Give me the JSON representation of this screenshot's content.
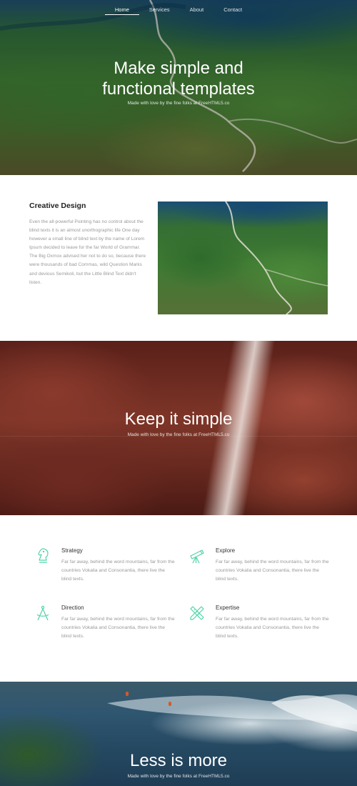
{
  "nav": {
    "items": [
      "Home",
      "Services",
      "About",
      "Contact"
    ],
    "active": "Home"
  },
  "hero": {
    "title_line1": "Make simple and",
    "title_line2": "functional templates",
    "subtitle": "Made with love by the fine folks at FreeHTML5.co"
  },
  "about": {
    "title": "Creative Design",
    "text": "Even the all-powerful Pointing has no control about the blind texts it is an almost unorthographic life One day however a small line of blind text by the name of Lorem Ipsum decided to leave for the far World of Grammar. The Big Oxmox advised her not to do so, because there were thousands of bad Commas, wild Question Marks and devious Semikoli, but the Little Blind Text didn't listen."
  },
  "banner2": {
    "title": "Keep it simple",
    "subtitle": "Made with love by the fine folks at FreeHTML5.co"
  },
  "services": {
    "accent_color": "#52d3aa",
    "items": [
      {
        "title": "Strategy",
        "icon": "chess-knight-icon",
        "text": "Far far away, behind the word mountains, far from the countries Vokalia and Consonantia, there live the blind texts."
      },
      {
        "title": "Explore",
        "icon": "telescope-icon",
        "text": "Far far away, behind the word mountains, far from the countries Vokalia and Consonantia, there live the blind texts."
      },
      {
        "title": "Direction",
        "icon": "compass-icon",
        "text": "Far far away, behind the word mountains, far from the countries Vokalia and Consonantia, there live the blind texts."
      },
      {
        "title": "Expertise",
        "icon": "pencil-ruler-icon",
        "text": "Far far away, behind the word mountains, far from the countries Vokalia and Consonantia, there live the blind texts."
      }
    ]
  },
  "banner3": {
    "title": "Less is more",
    "subtitle": "Made with love by the fine folks at FreeHTML5.co"
  }
}
